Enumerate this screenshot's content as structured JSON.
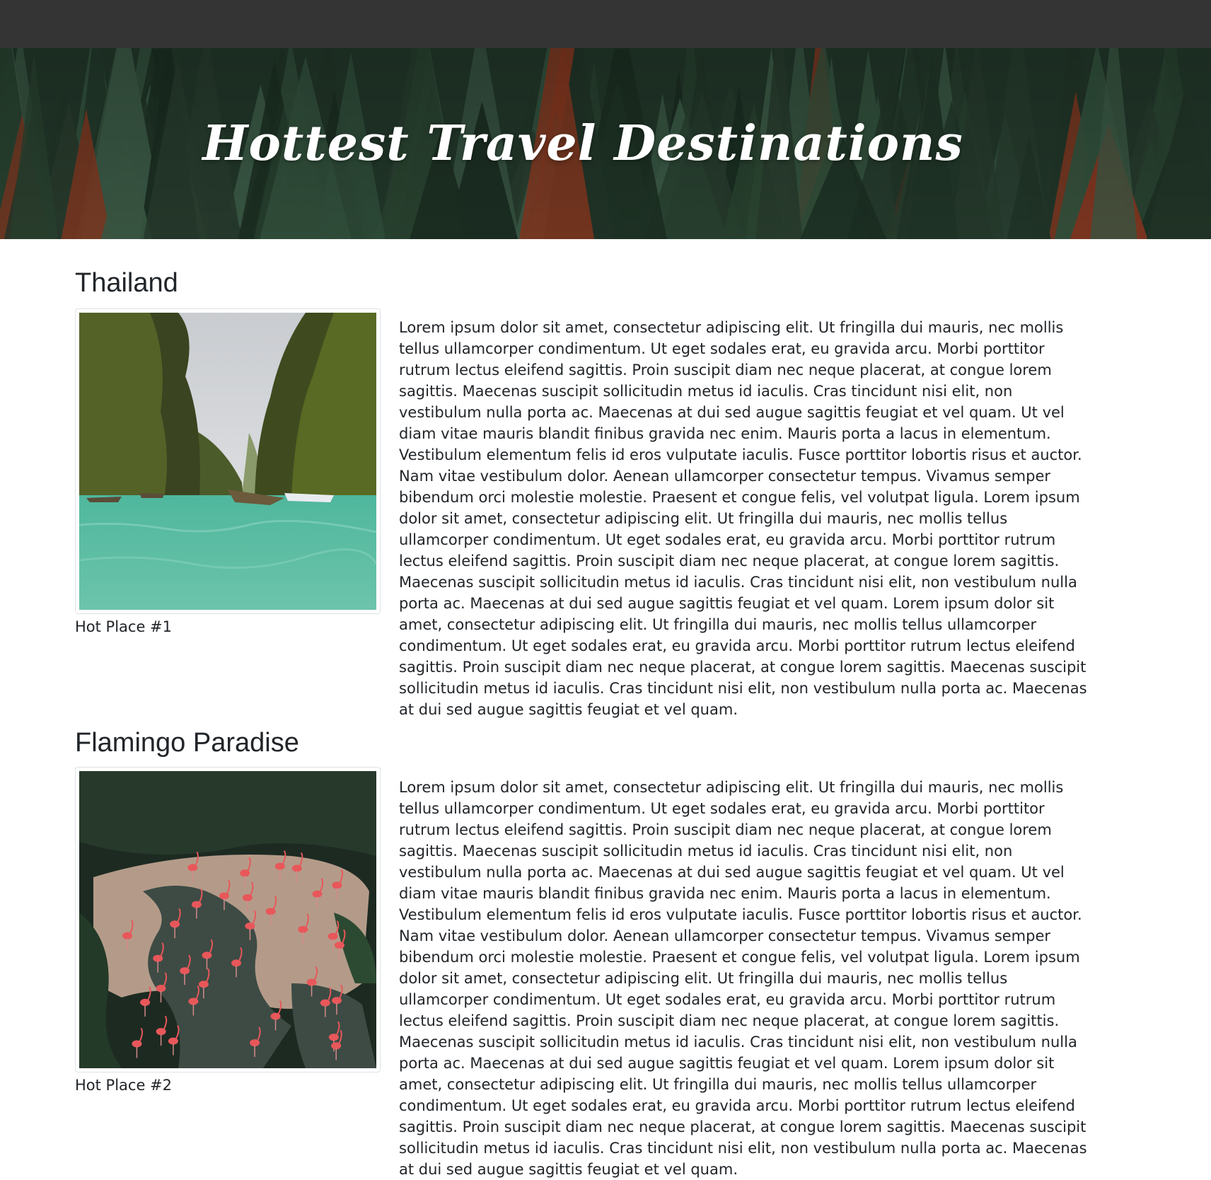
{
  "header": {
    "title": "Hottest Travel Destinations"
  },
  "destinations": [
    {
      "heading": "Thailand",
      "caption": "Hot Place #1",
      "image_icon": "limestone-cliffs-boats-photo",
      "description": "Lorem ipsum dolor sit amet, consectetur adipiscing elit. Ut fringilla dui mauris, nec mollis tellus ullamcorper condimentum. Ut eget sodales erat, eu gravida arcu. Morbi porttitor rutrum lectus eleifend sagittis. Proin suscipit diam nec neque placerat, at congue lorem sagittis. Maecenas suscipit sollicitudin metus id iaculis. Cras tincidunt nisi elit, non vestibulum nulla porta ac. Maecenas at dui sed augue sagittis feugiat et vel quam. Ut vel diam vitae mauris blandit finibus gravida nec enim. Mauris porta a lacus in elementum. Vestibulum elementum felis id eros vulputate iaculis. Fusce porttitor lobortis risus et auctor. Nam vitae vestibulum dolor. Aenean ullamcorper consectetur tempus. Vivamus semper bibendum orci molestie molestie. Praesent et congue felis, vel volutpat ligula. Lorem ipsum dolor sit amet, consectetur adipiscing elit. Ut fringilla dui mauris, nec mollis tellus ullamcorper condimentum. Ut eget sodales erat, eu gravida arcu. Morbi porttitor rutrum lectus eleifend sagittis. Proin suscipit diam nec neque placerat, at congue lorem sagittis. Maecenas suscipit sollicitudin metus id iaculis. Cras tincidunt nisi elit, non vestibulum nulla porta ac. Maecenas at dui sed augue sagittis feugiat et vel quam. Lorem ipsum dolor sit amet, consectetur adipiscing elit. Ut fringilla dui mauris, nec mollis tellus ullamcorper condimentum. Ut eget sodales erat, eu gravida arcu. Morbi porttitor rutrum lectus eleifend sagittis. Proin suscipit diam nec neque placerat, at congue lorem sagittis. Maecenas suscipit sollicitudin metus id iaculis. Cras tincidunt nisi elit, non vestibulum nulla porta ac. Maecenas at dui sed augue sagittis feugiat et vel quam."
    },
    {
      "heading": "Flamingo Paradise",
      "caption": "Hot Place #2",
      "image_icon": "flamingo-pond-photo",
      "description": "Lorem ipsum dolor sit amet, consectetur adipiscing elit. Ut fringilla dui mauris, nec mollis tellus ullamcorper condimentum. Ut eget sodales erat, eu gravida arcu. Morbi porttitor rutrum lectus eleifend sagittis. Proin suscipit diam nec neque placerat, at congue lorem sagittis. Maecenas suscipit sollicitudin metus id iaculis. Cras tincidunt nisi elit, non vestibulum nulla porta ac. Maecenas at dui sed augue sagittis feugiat et vel quam. Ut vel diam vitae mauris blandit finibus gravida nec enim. Mauris porta a lacus in elementum. Vestibulum elementum felis id eros vulputate iaculis. Fusce porttitor lobortis risus et auctor. Nam vitae vestibulum dolor. Aenean ullamcorper consectetur tempus. Vivamus semper bibendum orci molestie molestie. Praesent et congue felis, vel volutpat ligula. Lorem ipsum dolor sit amet, consectetur adipiscing elit. Ut fringilla dui mauris, nec mollis tellus ullamcorper condimentum. Ut eget sodales erat, eu gravida arcu. Morbi porttitor rutrum lectus eleifend sagittis. Proin suscipit diam nec neque placerat, at congue lorem sagittis. Maecenas suscipit sollicitudin metus id iaculis. Cras tincidunt nisi elit, non vestibulum nulla porta ac. Maecenas at dui sed augue sagittis feugiat et vel quam. Lorem ipsum dolor sit amet, consectetur adipiscing elit. Ut fringilla dui mauris, nec mollis tellus ullamcorper condimentum. Ut eget sodales erat, eu gravida arcu. Morbi porttitor rutrum lectus eleifend sagittis. Proin suscipit diam nec neque placerat, at congue lorem sagittis. Maecenas suscipit sollicitudin metus id iaculis. Cras tincidunt nisi elit, non vestibulum nulla porta ac. Maecenas at dui sed augue sagittis feugiat et vel quam."
    }
  ],
  "colors": {
    "topbar": "#343434",
    "forest_dark": "#1f3327",
    "text": "#212529"
  }
}
